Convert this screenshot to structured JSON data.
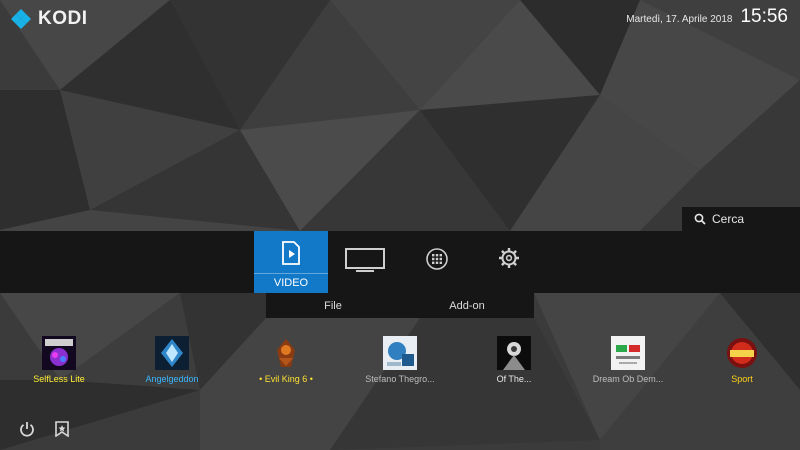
{
  "app": {
    "name": "KODI"
  },
  "clock": {
    "date": "Martedì, 17. Aprile 2018",
    "time": "15:56"
  },
  "search": {
    "label": "Cerca",
    "icon": "search-icon"
  },
  "main_menu": {
    "items": [
      {
        "id": "video",
        "label": "VIDEO",
        "icon": "video-file-icon",
        "active": true
      },
      {
        "id": "tv",
        "icon": "tv-icon"
      },
      {
        "id": "addons",
        "icon": "apps-grid-icon"
      },
      {
        "id": "settings",
        "icon": "gear-icon"
      }
    ],
    "accent": "#1278c8"
  },
  "submenu": {
    "items": [
      "File",
      "Add-on"
    ]
  },
  "addons": [
    {
      "label": "SelfLess Lite",
      "color": "#ffee33",
      "alt_color": "#3fd2ff"
    },
    {
      "label": "Angelgeddon",
      "color": "#39b7ff"
    },
    {
      "label": "• Evil King 6 •",
      "color": "#ffe033"
    },
    {
      "label": "Stefano Thegro...",
      "color": "#bdbdbd"
    },
    {
      "label": "Of The...",
      "color": "#e8e8e8"
    },
    {
      "label": "Dream Ob Dem...",
      "color": "#bdbdbd"
    },
    {
      "label": "Sport",
      "color": "#ffd21a"
    }
  ],
  "bottom": {
    "icons": [
      "power-icon",
      "favourites-icon"
    ]
  }
}
